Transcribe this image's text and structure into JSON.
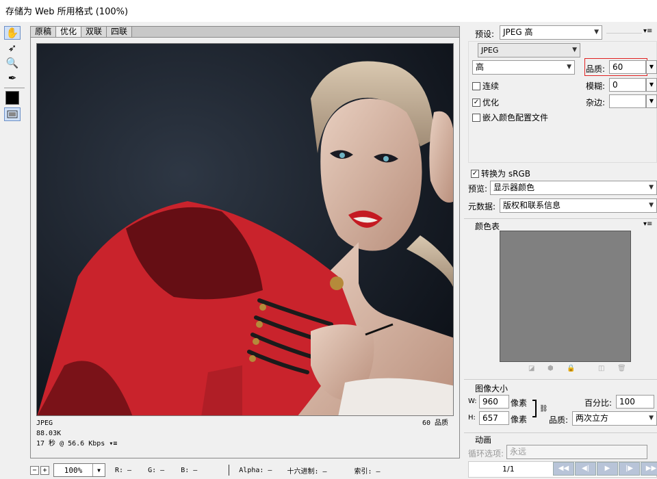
{
  "window": {
    "title": "存储为 Web 所用格式 (100%)"
  },
  "tools": [
    {
      "name": "hand-tool-icon",
      "glyph": "✋"
    },
    {
      "name": "slice-select-tool-icon",
      "glyph": "➶"
    },
    {
      "name": "zoom-tool-icon",
      "glyph": "🔍"
    },
    {
      "name": "eyedropper-tool-icon",
      "glyph": "✒"
    }
  ],
  "tabs": [
    "原稿",
    "优化",
    "双联",
    "四联"
  ],
  "active_tab": 1,
  "info": {
    "format": "JPEG",
    "size": "88.03K",
    "time": "17 秒 @ 56.6 Kbps",
    "quality_label": "60 品质"
  },
  "statusbar": {
    "zoom": "100%",
    "r": "R: —",
    "g": "G: —",
    "b": "B: —",
    "alpha": "Alpha: —",
    "hex": "十六进制: —",
    "index": "索引: —"
  },
  "settings": {
    "preset_label": "预设:",
    "preset_value": "JPEG 高",
    "format_value": "JPEG",
    "quality_level": "高",
    "quality_label": "品质:",
    "quality_value": "60",
    "progressive_label": "连续",
    "optimized_label": "优化",
    "embed_profile_label": "嵌入颜色配置文件",
    "blur_label": "模糊:",
    "blur_value": "0",
    "matte_label": "杂边:",
    "matte_value": "",
    "srgb_label": "转换为 sRGB",
    "preview_label": "预览:",
    "preview_value": "显示器颜色",
    "metadata_label": "元数据:",
    "metadata_value": "版权和联系信息"
  },
  "color_table": {
    "title": "颜色表"
  },
  "image_size": {
    "title": "图像大小",
    "w_label": "W:",
    "w_value": "960",
    "h_label": "H:",
    "h_value": "657",
    "unit": "像素",
    "percent_label": "百分比:",
    "percent_value": "100",
    "quality_label": "品质:",
    "quality_value": "两次立方"
  },
  "animation": {
    "title": "动画",
    "loop_label": "循环选项:",
    "loop_value": "永远",
    "frame": "1/1"
  }
}
